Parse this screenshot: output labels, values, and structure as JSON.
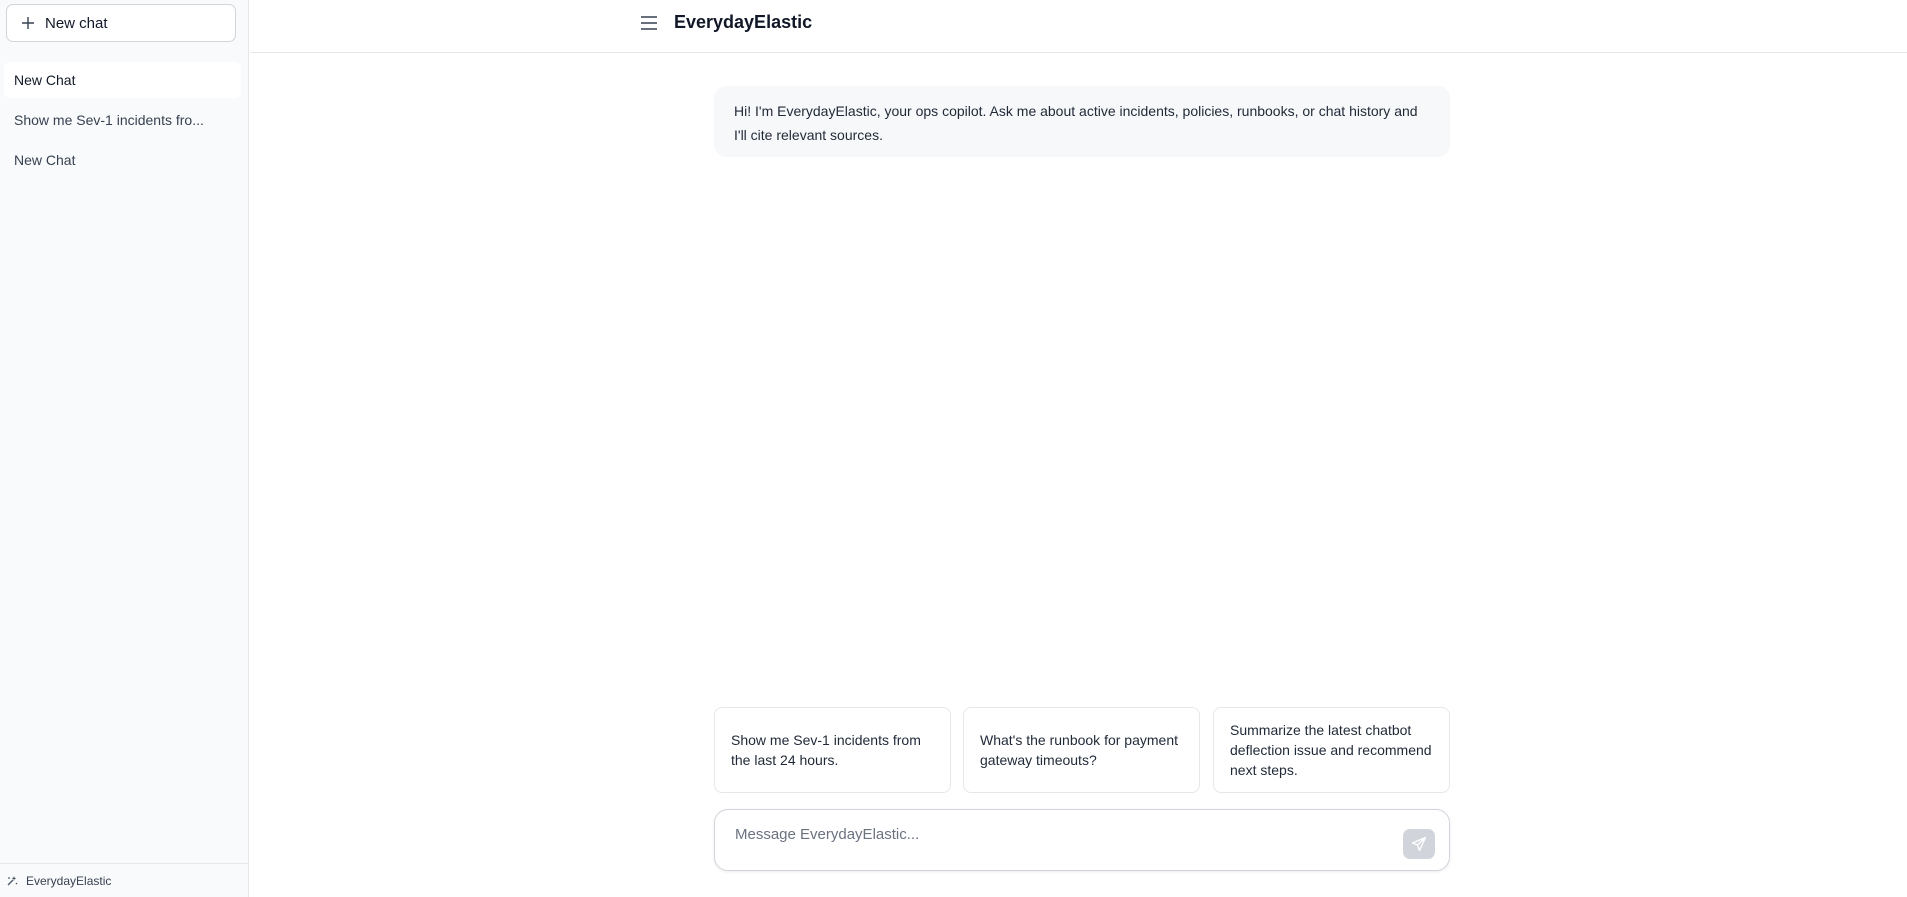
{
  "sidebar": {
    "new_chat_label": "New chat",
    "chats": [
      {
        "label": "New Chat",
        "active": true
      },
      {
        "label": "Show me Sev-1 incidents fro...",
        "active": false
      },
      {
        "label": "New Chat",
        "active": false
      }
    ],
    "footer_label": "EverydayElastic"
  },
  "header": {
    "title": "EverydayElastic",
    "menu_icon": "hamburger-menu-icon"
  },
  "messages": [
    {
      "role": "assistant",
      "text": "Hi! I'm EverydayElastic, your ops copilot. Ask me about active incidents, policies, runbooks, or chat history and I'll cite relevant sources."
    }
  ],
  "suggestions": [
    "Show me Sev-1 incidents from the last 24 hours.",
    "What's the runbook for payment gateway timeouts?",
    "Summarize the latest chatbot deflection issue and recommend next steps."
  ],
  "composer": {
    "placeholder": "Message EverydayElastic...",
    "value": "",
    "send_icon": "send-icon"
  },
  "colors": {
    "sidebar_bg": "#f9fafb",
    "border": "#e5e7eb",
    "message_bg": "#f7f8fa",
    "send_button_disabled": "#d1d5db"
  }
}
